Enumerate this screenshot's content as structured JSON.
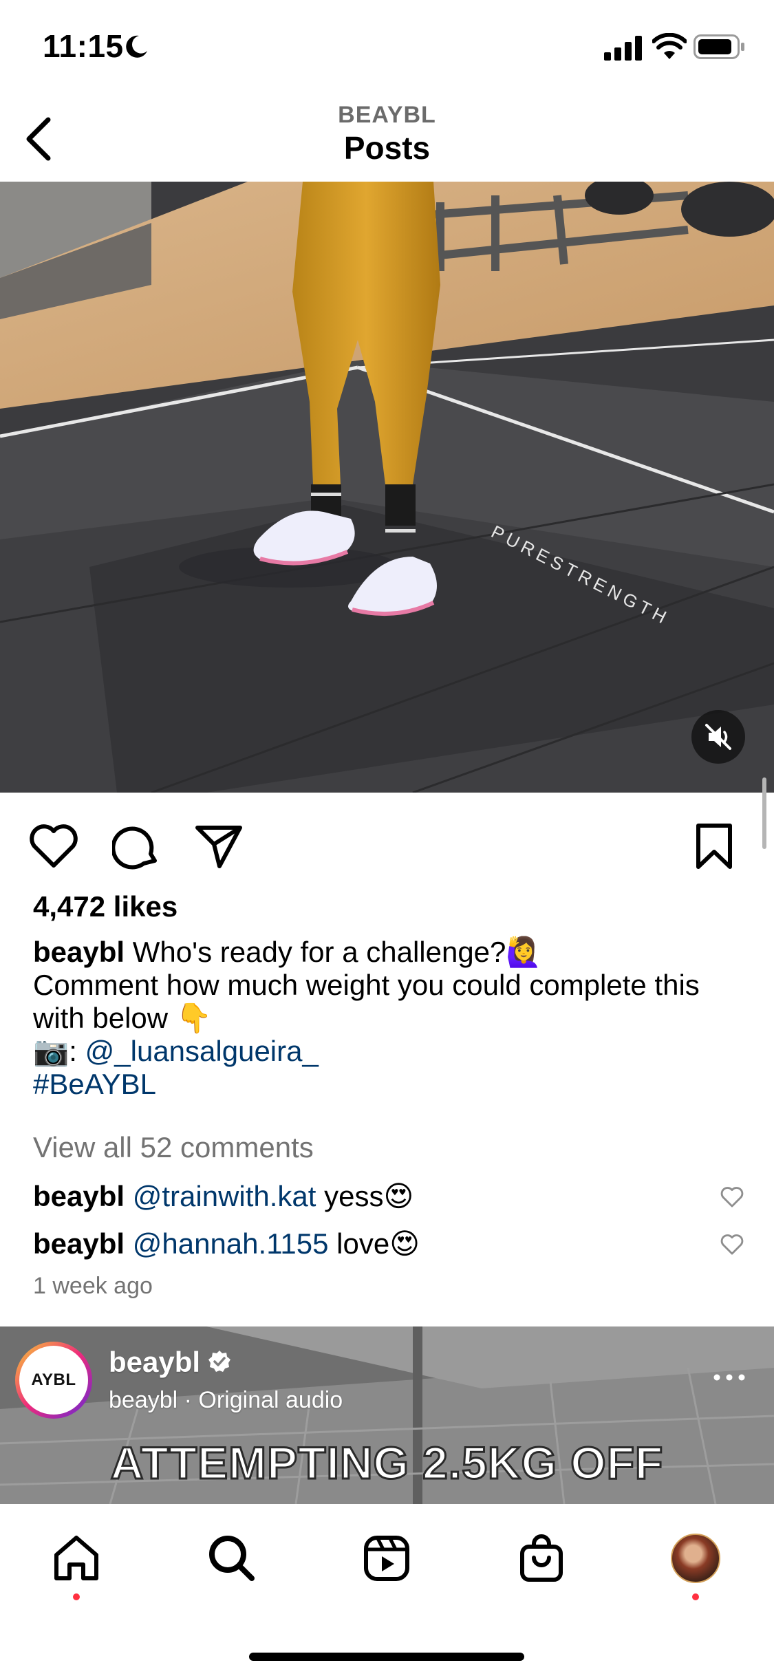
{
  "status_bar": {
    "time": "11:15"
  },
  "header": {
    "account": "BEAYBL",
    "title": "Posts"
  },
  "post": {
    "likes": "4,472 likes",
    "caption": {
      "username": "beaybl",
      "text_line1": "Who's ready for a challenge?🙋‍♀️",
      "text_line2": "Comment how much weight you could complete this",
      "text_line3": "with below 👇",
      "credit_prefix": "📷: ",
      "credit_handle": "@_luansalgueira_",
      "hashtag": "#BeAYBL"
    },
    "view_comments": "View all 52 comments",
    "comments": [
      {
        "username": "beaybl",
        "mention": "@trainwith.kat",
        "text": " yess😍"
      },
      {
        "username": "beaybl",
        "mention": "@hannah.1155",
        "text": " love😍"
      }
    ],
    "timestamp": "1 week ago",
    "media_floor_text": "PURESTRENGTH"
  },
  "next_post": {
    "avatar_text": "AYBL",
    "username": "beaybl",
    "audio": "beaybl · Original audio",
    "overlay_text": "ATTEMPTING 2.5KG OFF"
  },
  "tabs": [
    {
      "name": "home",
      "icon": "home-icon",
      "notification": true
    },
    {
      "name": "search",
      "icon": "search-icon",
      "notification": false
    },
    {
      "name": "reels",
      "icon": "reels-icon",
      "notification": false
    },
    {
      "name": "shop",
      "icon": "shop-icon",
      "notification": false
    },
    {
      "name": "profile",
      "icon": "profile-avatar",
      "notification": true
    }
  ],
  "colors": {
    "link": "#00376b",
    "notification": "#ff3040",
    "muted": "#737373"
  }
}
